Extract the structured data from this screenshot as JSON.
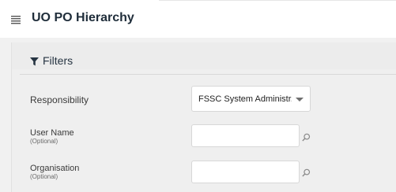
{
  "header": {
    "title": "UO PO Hierarchy",
    "menu_icon": "hamburger-menu-icon"
  },
  "filters": {
    "title": "Filters",
    "icon": "filter-icon",
    "fields": [
      {
        "label": "Responsibility",
        "type": "select",
        "value": "FSSC System Administr..."
      },
      {
        "label": "User Name",
        "sublabel": "(Optional)",
        "type": "lookup",
        "value": "",
        "icon": "search-icon"
      },
      {
        "label": "Organisation",
        "sublabel": "(Optional)",
        "type": "lookup",
        "value": "",
        "icon": "search-icon"
      }
    ]
  }
}
